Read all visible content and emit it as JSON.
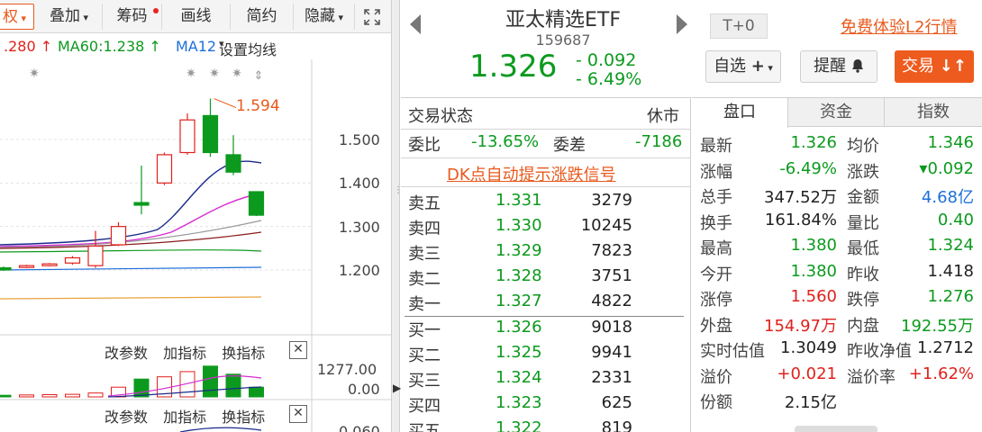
{
  "toolbar": {
    "items": [
      "权",
      "叠加",
      "筹码",
      "画线",
      "简约",
      "隐藏"
    ],
    "expand_icon": "expand-arrows-icon"
  },
  "ma_legend": {
    "ma_cut": ".280 ↑",
    "ma60": "MA60:1.238 ↑",
    "ma120": "MA12",
    "settings": "设置均线"
  },
  "chart": {
    "peak_label": "1.594",
    "price_ticks": [
      "1.500",
      "1.400",
      "1.300",
      "1.200"
    ],
    "volume_ticks": [
      "1277.00",
      "0.00"
    ],
    "macd_tick": "0.060",
    "indicator_bar": [
      "改参数",
      "加指标",
      "换指标"
    ],
    "candles": [
      {
        "o": 1.205,
        "c": 1.2,
        "h": 1.208,
        "l": 1.198
      },
      {
        "o": 1.206,
        "c": 1.21,
        "h": 1.212,
        "l": 1.204
      },
      {
        "o": 1.21,
        "c": 1.214,
        "h": 1.216,
        "l": 1.208
      },
      {
        "o": 1.216,
        "c": 1.228,
        "h": 1.232,
        "l": 1.212
      },
      {
        "o": 1.21,
        "c": 1.255,
        "h": 1.29,
        "l": 1.205
      },
      {
        "o": 1.258,
        "c": 1.3,
        "h": 1.31,
        "l": 1.255
      },
      {
        "o": 1.355,
        "c": 1.349,
        "h": 1.44,
        "l": 1.328
      },
      {
        "o": 1.4,
        "c": 1.465,
        "h": 1.47,
        "l": 1.395
      },
      {
        "o": 1.47,
        "c": 1.545,
        "h": 1.56,
        "l": 1.465
      },
      {
        "o": 1.555,
        "c": 1.47,
        "h": 1.594,
        "l": 1.46
      },
      {
        "o": 1.465,
        "c": 1.425,
        "h": 1.51,
        "l": 1.418
      },
      {
        "o": 1.38,
        "c": 1.326,
        "h": 1.38,
        "l": 1.324
      }
    ],
    "volumes": [
      0.05,
      0.06,
      0.07,
      0.08,
      0.12,
      0.3,
      0.55,
      0.62,
      0.78,
      0.95,
      0.7,
      0.3
    ]
  },
  "header": {
    "name": "亚太精选ETF",
    "code": "159687",
    "price": "1.326",
    "change": "- 0.092",
    "change_pct": "- 6.49%",
    "t0": "T+0",
    "l2_link": "免费体验L2行情",
    "watch_label": "自选",
    "remind_label": "提醒",
    "trade_label": "交易"
  },
  "order_book": {
    "status_label": "交易状态",
    "status_value": "休市",
    "ratio_label": "委比",
    "ratio_value": "-13.65%",
    "diff_label": "委差",
    "diff_value": "-7186",
    "dk_link": "DK点自动提示涨跌信号",
    "asks": [
      {
        "label": "卖五",
        "price": "1.331",
        "vol": "3279"
      },
      {
        "label": "卖四",
        "price": "1.330",
        "vol": "10245"
      },
      {
        "label": "卖三",
        "price": "1.329",
        "vol": "7823"
      },
      {
        "label": "卖二",
        "price": "1.328",
        "vol": "3751"
      },
      {
        "label": "卖一",
        "price": "1.327",
        "vol": "4822"
      }
    ],
    "bids": [
      {
        "label": "买一",
        "price": "1.326",
        "vol": "9018"
      },
      {
        "label": "买二",
        "price": "1.325",
        "vol": "9941"
      },
      {
        "label": "买三",
        "price": "1.324",
        "vol": "2331"
      },
      {
        "label": "买四",
        "price": "1.323",
        "vol": "625"
      },
      {
        "label": "买五",
        "price": "1.322",
        "vol": "819"
      }
    ]
  },
  "tabs": [
    "盘口",
    "资金",
    "指数"
  ],
  "stats": [
    {
      "l1": "最新",
      "v1": "1.326",
      "c1": "green",
      "l2": "均价",
      "v2": "1.346",
      "c2": "green"
    },
    {
      "l1": "涨幅",
      "v1": "-6.49%",
      "c1": "green",
      "l2": "涨跌",
      "v2": "▾0.092",
      "c2": "green"
    },
    {
      "l1": "总手",
      "v1": "347.52万",
      "c1": "dark",
      "l2": "金额",
      "v2": "4.68亿",
      "c2": "blue"
    },
    {
      "l1": "换手",
      "v1": "161.84%",
      "c1": "dark",
      "l2": "量比",
      "v2": "0.40",
      "c2": "green"
    },
    {
      "l1": "最高",
      "v1": "1.380",
      "c1": "green",
      "l2": "最低",
      "v2": "1.324",
      "c2": "green"
    },
    {
      "l1": "今开",
      "v1": "1.380",
      "c1": "green",
      "l2": "昨收",
      "v2": "1.418",
      "c2": "dark"
    },
    {
      "l1": "涨停",
      "v1": "1.560",
      "c1": "red",
      "l2": "跌停",
      "v2": "1.276",
      "c2": "green"
    },
    {
      "l1": "外盘",
      "v1": "154.97万",
      "c1": "red",
      "l2": "内盘",
      "v2": "192.55万",
      "c2": "green"
    },
    {
      "l1": "实时估值",
      "v1": "1.3049",
      "c1": "dark",
      "l2": "昨收净值",
      "v2": "1.2712",
      "c2": "dark"
    },
    {
      "l1": "溢价",
      "v1": "+0.021",
      "c1": "red",
      "l2": "溢价率",
      "v2": "+1.62%",
      "c2": "red"
    },
    {
      "l1": "份额",
      "v1": "2.15亿",
      "c1": "dark",
      "l2": "",
      "v2": "",
      "c2": "dark"
    }
  ],
  "colors": {
    "up_red": "#e0211c",
    "down_green": "#0c9a1e",
    "accent_orange": "#ee5b1e",
    "blue": "#1e6fd9"
  }
}
